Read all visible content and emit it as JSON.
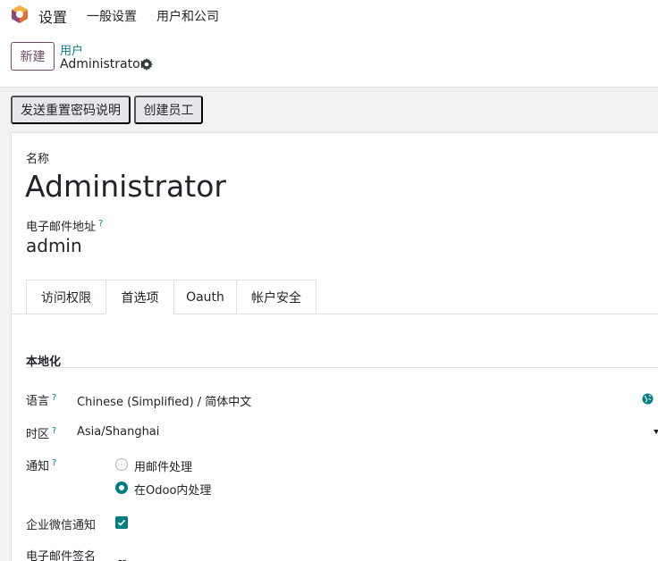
{
  "navbar": {
    "app_title": "设置",
    "menu": [
      "一般设置",
      "用户和公司"
    ]
  },
  "control_panel": {
    "new_button": "新建",
    "breadcrumb_parent": "用户",
    "record_name": "Administrator"
  },
  "actions": [
    "发送重置密码说明",
    "创建员工"
  ],
  "form": {
    "name_label": "名称",
    "name_value": "Administrator",
    "email_label": "电子邮件地址",
    "email_value": "admin",
    "help_mark": "?"
  },
  "tabs": [
    {
      "label": "访问权限",
      "active": false
    },
    {
      "label": "首选项",
      "active": true
    },
    {
      "label": "Oauth",
      "active": false
    },
    {
      "label": "帐户安全",
      "active": false
    }
  ],
  "localization": {
    "section_title": "本地化",
    "language_label": "语言",
    "language_value": "Chinese (Simplified) / 简体中文",
    "timezone_label": "时区",
    "timezone_value": "Asia/Shanghai",
    "notification_label": "通知",
    "notification_options": [
      {
        "label": "用邮件处理",
        "checked": false
      },
      {
        "label": "在Odoo内处理",
        "checked": true
      }
    ],
    "wechat_label": "企业微信通知",
    "wechat_checked": true,
    "signature_label": "电子邮件签名",
    "signature_value": "--"
  },
  "colors": {
    "accent": "#017e84",
    "brand": "#714b67"
  },
  "icons": {
    "logo": "odoo-logo-icon",
    "gear": "gear-icon",
    "globe": "globe-icon",
    "caret": "caret-down-icon",
    "check": "check-icon"
  }
}
